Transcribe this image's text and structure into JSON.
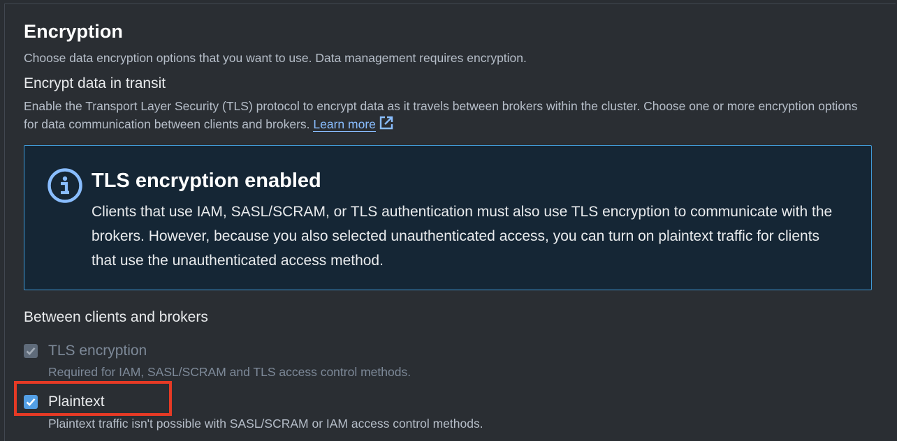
{
  "section": {
    "title": "Encryption",
    "description": "Choose data encryption options that you want to use. Data management requires encryption."
  },
  "transit": {
    "title": "Encrypt data in transit",
    "description": "Enable the Transport Layer Security (TLS) protocol to encrypt data as it travels between brokers within the cluster. Choose one or more encryption options for data communication between clients and brokers.",
    "learn_more": "Learn more",
    "learn_more_icon": "external-link-icon"
  },
  "alert": {
    "type": "info",
    "icon": "info-icon",
    "title": "TLS encryption enabled",
    "body": "Clients that use IAM, SASL/SCRAM, or TLS authentication must also use TLS encryption to communicate with the brokers. However, because you also selected unauthenticated access, you can turn on plaintext traffic for clients that use the unauthenticated access method."
  },
  "clients_brokers": {
    "label": "Between clients and brokers",
    "options": [
      {
        "label": "TLS encryption",
        "hint": "Required for IAM, SASL/SCRAM and TLS access control methods.",
        "checked": true,
        "disabled": true
      },
      {
        "label": "Plaintext",
        "hint": "Plaintext traffic isn't possible with SASL/SCRAM or IAM access control methods.",
        "checked": true,
        "disabled": false,
        "highlighted": true
      }
    ]
  },
  "colors": {
    "background": "#2a2e33",
    "alert_background": "#152635",
    "alert_border": "#419ad6",
    "link": "#89bdff",
    "checkbox_active": "#539fe5",
    "checkbox_disabled": "#5f6b7a",
    "highlight": "#e53a25"
  }
}
